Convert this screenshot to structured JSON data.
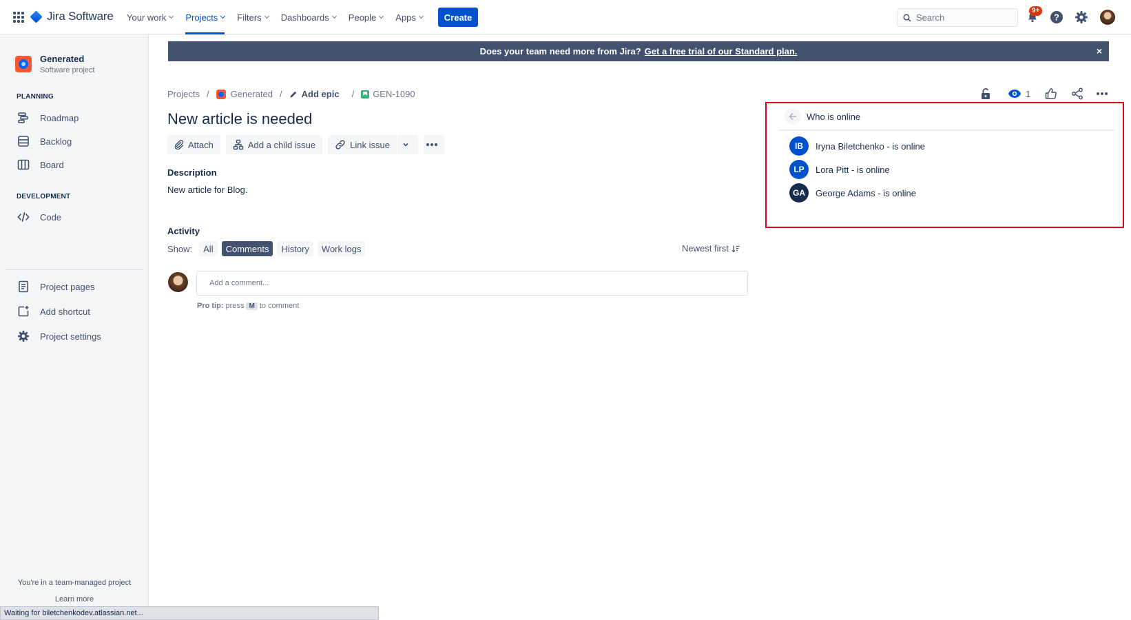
{
  "topnav": {
    "logo": "Jira Software",
    "items": [
      {
        "label": "Your work",
        "active": false
      },
      {
        "label": "Projects",
        "active": true
      },
      {
        "label": "Filters",
        "active": false
      },
      {
        "label": "Dashboards",
        "active": false
      },
      {
        "label": "People",
        "active": false
      },
      {
        "label": "Apps",
        "active": false
      }
    ],
    "create_label": "Create",
    "search_placeholder": "Search",
    "notification_badge": "9+",
    "icons": [
      "app-switcher-icon",
      "notifications-icon",
      "help-icon",
      "settings-icon",
      "profile-avatar"
    ]
  },
  "sidebar": {
    "project_name": "Generated",
    "project_type": "Software project",
    "planning_title": "PLANNING",
    "planning_items": [
      {
        "label": "Roadmap",
        "icon": "roadmap-icon"
      },
      {
        "label": "Backlog",
        "icon": "backlog-icon"
      },
      {
        "label": "Board",
        "icon": "board-icon"
      }
    ],
    "development_title": "DEVELOPMENT",
    "development_items": [
      {
        "label": "Code",
        "icon": "code-icon"
      }
    ],
    "other_items": [
      {
        "label": "Project pages",
        "icon": "pages-icon"
      },
      {
        "label": "Add shortcut",
        "icon": "add-shortcut-icon"
      },
      {
        "label": "Project settings",
        "icon": "settings-icon"
      }
    ],
    "footer_text": "You're in a team-managed project",
    "footer_link": "Learn more"
  },
  "status_bar": "Waiting for biletchenkodev.atlassian.net...",
  "banner": {
    "text": "Does your team need more from Jira?",
    "link": "Get a free trial of our Standard plan.",
    "close": "×"
  },
  "breadcrumb": {
    "projects": "Projects",
    "project": "Generated",
    "epic": "Add epic",
    "issue_key": "GEN-1090",
    "separator": "/"
  },
  "issue": {
    "title": "New article is needed",
    "toolbar": {
      "attach": "Attach",
      "child": "Add a child issue",
      "link": "Link issue"
    },
    "description_label": "Description",
    "description": "New article for Blog.",
    "activity_label": "Activity",
    "show_label": "Show:",
    "filters": [
      {
        "label": "All",
        "active": false
      },
      {
        "label": "Comments",
        "active": true
      },
      {
        "label": "History",
        "active": false
      },
      {
        "label": "Work logs",
        "active": false
      }
    ],
    "sort_label": "Newest first",
    "comment_placeholder": "Add a comment...",
    "pro_tip_label": "Pro tip:",
    "pro_tip_pre": "press",
    "pro_tip_key": "M",
    "pro_tip_post": "to comment"
  },
  "header_actions": {
    "watch_count": "1"
  },
  "online_panel": {
    "title": "Who is online",
    "users": [
      {
        "initials": "IB",
        "text": "Iryna Biletchenko - is online",
        "color": "#0052CC"
      },
      {
        "initials": "LP",
        "text": "Lora Pitt - is online",
        "color": "#0052CC"
      },
      {
        "initials": "GA",
        "text": "George Adams - is online",
        "color": "#172B4D"
      }
    ],
    "highlight_color": "#E3001B"
  }
}
